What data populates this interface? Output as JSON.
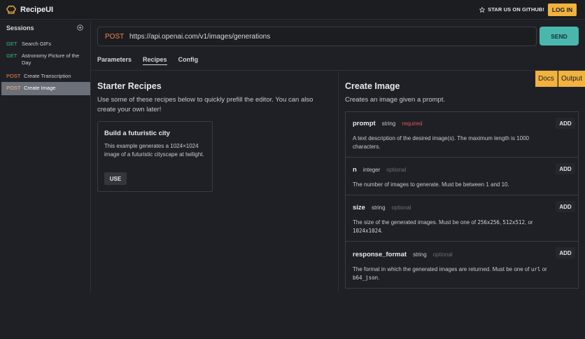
{
  "header": {
    "logo_text": "RecipeUI",
    "star_label": "STAR US ON GITHUB!",
    "login_label": "LOG IN"
  },
  "sidebar": {
    "title": "Sessions",
    "items": [
      {
        "method": "GET",
        "label": "Search GIFs"
      },
      {
        "method": "GET",
        "label": "Astronomy Picture of the Day"
      },
      {
        "method": "POST",
        "label": "Create Transcription"
      },
      {
        "method": "POST",
        "label": "Create Image"
      }
    ]
  },
  "request": {
    "method": "POST",
    "url": "https://api.openai.com/v1/images/generations",
    "send_label": "SEND"
  },
  "tabs": [
    {
      "label": "Parameters"
    },
    {
      "label": "Recipes"
    },
    {
      "label": "Config"
    }
  ],
  "starter": {
    "title": "Starter Recipes",
    "description": "Use some of these recipes below to quickly prefill the editor. You can also create your own later!",
    "card": {
      "title": "Build a futuristic city",
      "description": "This example generates a 1024×1024 image of a futuristic cityscape at twilight.",
      "use_label": "USE"
    }
  },
  "docs": {
    "docs_label": "Docs",
    "output_label": "Output",
    "title": "Create Image",
    "description": "Creates an image given a prompt.",
    "params": [
      {
        "name": "prompt",
        "type": "string",
        "req": "required",
        "add": "ADD",
        "desc": "A text description of the desired image(s). The maximum length is 1000 characters."
      },
      {
        "name": "n",
        "type": "integer",
        "req": "optional",
        "add": "ADD",
        "desc": "The number of images to generate. Must be between 1 and 10."
      },
      {
        "name": "size",
        "type": "string",
        "req": "optional",
        "add": "ADD",
        "desc_pre": "The size of the generated images. Must be one of ",
        "code1": "256x256",
        "sep1": ", ",
        "code2": "512x512",
        "sep2": ", or ",
        "code3": "1024x1024",
        "desc_post": "."
      },
      {
        "name": "response_format",
        "type": "string",
        "req": "optional",
        "add": "ADD",
        "desc_pre": "The format in which the generated images are returned. Must be one of ",
        "code1": "url",
        "sep1": " or ",
        "code2": "b64_json",
        "desc_post": "."
      }
    ]
  },
  "colors": {
    "accent": "#f2b23e",
    "send": "#4ab7ac",
    "get": "#3dba7c",
    "post": "#f08a4b",
    "required": "#e0564f"
  }
}
